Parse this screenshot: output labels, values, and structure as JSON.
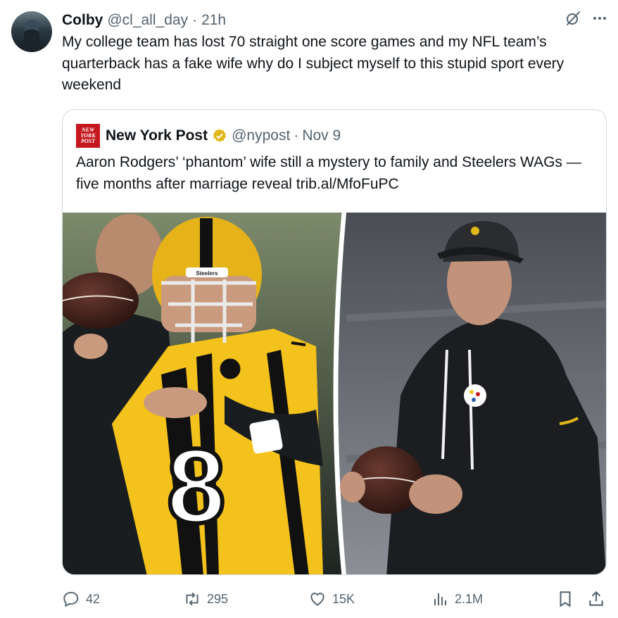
{
  "author": {
    "name": "Colby",
    "handle": "@cl_all_day",
    "time": "21h"
  },
  "tweet_text": "My college team has lost 70 straight one score games and my NFL team’s quarterback has a fake wife why do I subject myself to this stupid sport every weekend",
  "quote": {
    "logo_text": "NEW YORK POST",
    "name": "New York Post",
    "handle": "@nypost",
    "date": "Nov 9",
    "text": "Aaron Rodgers’ ‘phantom’ wife still a mystery to family and Steelers WAGs — five months after marriage reveal trib.al/MfoFuPC",
    "jersey_number": "8",
    "helmet_text": "Steelers"
  },
  "stats": {
    "replies": "42",
    "reposts": "295",
    "likes": "15K",
    "views": "2.1M"
  },
  "colors": {
    "text": "#0f1419",
    "secondary": "#536471",
    "border": "#cfd9de",
    "nyp_red": "#c4161c",
    "gold": "#f5c518"
  },
  "icons": [
    "grok-icon",
    "more-icon",
    "verified-icon",
    "reply-icon",
    "repost-icon",
    "like-icon",
    "views-icon",
    "bookmark-icon",
    "share-icon"
  ]
}
